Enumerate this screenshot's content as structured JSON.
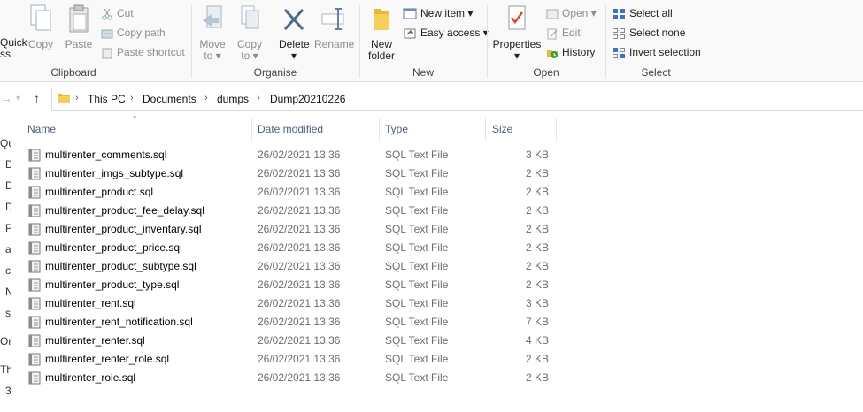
{
  "ribbon": {
    "clipboard": {
      "label": "Clipboard",
      "quick_access_top": "Quick",
      "quick_access_bottom": "ss",
      "copy": "Copy",
      "paste": "Paste",
      "cut": "Cut",
      "copy_path": "Copy path",
      "paste_shortcut": "Paste shortcut"
    },
    "organise": {
      "label": "Organise",
      "move_to_top": "Move",
      "move_to_bottom": "to",
      "copy_to_top": "Copy",
      "copy_to_bottom": "to",
      "delete": "Delete",
      "rename": "Rename"
    },
    "new": {
      "label": "New",
      "new_folder_top": "New",
      "new_folder_bottom": "folder",
      "new_item": "New item",
      "easy_access": "Easy access"
    },
    "open": {
      "label": "Open",
      "properties": "Properties",
      "open": "Open",
      "edit": "Edit",
      "history": "History"
    },
    "select": {
      "label": "Select",
      "select_all": "Select all",
      "select_none": "Select none",
      "invert_selection": "Invert selection"
    }
  },
  "address": {
    "crumbs": [
      "This PC",
      "Documents",
      "dumps",
      "Dump20210226"
    ]
  },
  "left_pane": [
    "Qu",
    "D",
    "D",
    "D",
    "P",
    "a",
    "c",
    "N",
    "s",
    "On",
    "Th",
    "3"
  ],
  "columns": {
    "name": "Name",
    "date": "Date modified",
    "type": "Type",
    "size": "Size"
  },
  "files": [
    {
      "name": "multirenter_comments.sql",
      "date": "26/02/2021 13:36",
      "type": "SQL Text File",
      "size": "3 KB"
    },
    {
      "name": "multirenter_imgs_subtype.sql",
      "date": "26/02/2021 13:36",
      "type": "SQL Text File",
      "size": "2 KB"
    },
    {
      "name": "multirenter_product.sql",
      "date": "26/02/2021 13:36",
      "type": "SQL Text File",
      "size": "2 KB"
    },
    {
      "name": "multirenter_product_fee_delay.sql",
      "date": "26/02/2021 13:36",
      "type": "SQL Text File",
      "size": "2 KB"
    },
    {
      "name": "multirenter_product_inventary.sql",
      "date": "26/02/2021 13:36",
      "type": "SQL Text File",
      "size": "2 KB"
    },
    {
      "name": "multirenter_product_price.sql",
      "date": "26/02/2021 13:36",
      "type": "SQL Text File",
      "size": "2 KB"
    },
    {
      "name": "multirenter_product_subtype.sql",
      "date": "26/02/2021 13:36",
      "type": "SQL Text File",
      "size": "2 KB"
    },
    {
      "name": "multirenter_product_type.sql",
      "date": "26/02/2021 13:36",
      "type": "SQL Text File",
      "size": "2 KB"
    },
    {
      "name": "multirenter_rent.sql",
      "date": "26/02/2021 13:36",
      "type": "SQL Text File",
      "size": "3 KB"
    },
    {
      "name": "multirenter_rent_notification.sql",
      "date": "26/02/2021 13:36",
      "type": "SQL Text File",
      "size": "7 KB"
    },
    {
      "name": "multirenter_renter.sql",
      "date": "26/02/2021 13:36",
      "type": "SQL Text File",
      "size": "4 KB"
    },
    {
      "name": "multirenter_renter_role.sql",
      "date": "26/02/2021 13:36",
      "type": "SQL Text File",
      "size": "2 KB"
    },
    {
      "name": "multirenter_role.sql",
      "date": "26/02/2021 13:36",
      "type": "SQL Text File",
      "size": "2 KB"
    }
  ]
}
